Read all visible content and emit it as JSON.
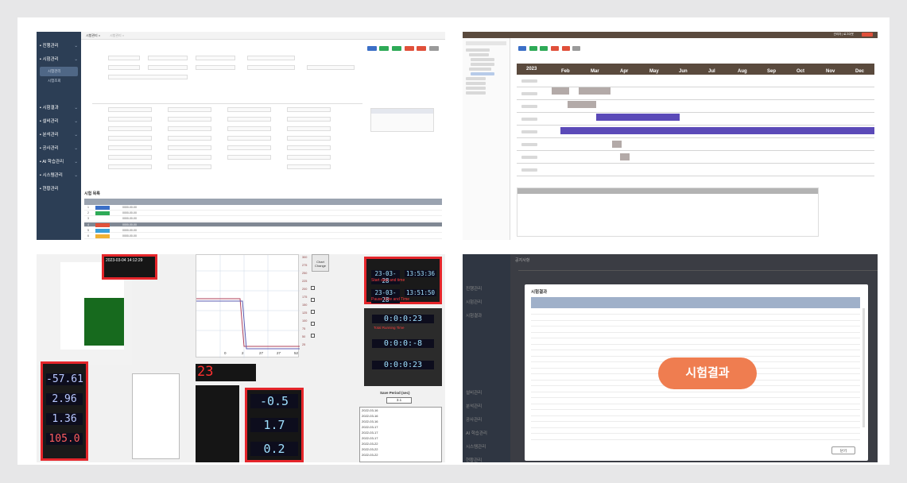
{
  "panel_top_left": {
    "tabs": [
      "시험관리 ×",
      "시험관리 ×"
    ],
    "sidebar": [
      {
        "label": "진행관리"
      },
      {
        "label": "시험관리"
      },
      {
        "label": "시험결과"
      },
      {
        "label": "설비관리"
      },
      {
        "label": "분석관리"
      },
      {
        "label": "공사관리"
      },
      {
        "label": "AI 학습관리"
      },
      {
        "label": "시스템관리"
      },
      {
        "label": "현황관리"
      }
    ],
    "sub_selected": "시험관리",
    "sub_other": "시험조회",
    "section_title": "시험 목록",
    "dates": [
      "0000-00-00",
      "0000-00-00",
      "0000-00-00",
      "0000-00-00",
      "0000-00-00",
      "0000-00-00",
      "0000-00-00",
      "0000-00-00"
    ],
    "row_numbers": [
      "1",
      "2",
      "3",
      "4",
      "5",
      "6",
      "7",
      "8"
    ],
    "chip_colors": [
      "#3b6fc7",
      "#2eaa57",
      "#ffffff",
      "#e0503a",
      "#3aa0d8",
      "#f0b133",
      "#27a9c9",
      "#2eaa57"
    ],
    "button_colors": [
      "#3b6fc7",
      "#2eaa57",
      "#2eaa57",
      "#e0503a",
      "#e0503a",
      "#9a9a9a"
    ]
  },
  "panel_top_right": {
    "year": "2023",
    "months": [
      "Feb",
      "Mar",
      "Apr",
      "May",
      "Jun",
      "Jul",
      "Aug",
      "Sep",
      "Oct",
      "Nov",
      "Dec"
    ],
    "top_status": "관리자 | 로그아웃"
  },
  "panel_bottom_left": {
    "timestamp": "2023-03-04 14:12:29",
    "readouts": [
      "-57.61",
      "2.96",
      "1.36",
      "105.0"
    ],
    "right_readouts": [
      "-0.5",
      "1.7",
      "0.2"
    ],
    "big_number": "23",
    "start_date": "23-03-28",
    "start_time": "13:53:36",
    "pause_date": "23-03-28",
    "pause_time": "13:51:50",
    "total_time": "0:0:0:23",
    "neg_time": "0:0:0:-8",
    "run_time": "0:0:0:23",
    "start_caption": "Start date and time",
    "pause_caption": "Pause Date and Time",
    "total_caption": "Total Running Time",
    "save_period_label": "Save Period (sec)",
    "save_period_value": "3.1",
    "chart_change": "Chart Change",
    "axis_ticks": [
      "0",
      "2",
      "27",
      "27",
      "52"
    ],
    "right_axis": [
      "300",
      "275",
      "250",
      "225",
      "200",
      "175",
      "150",
      "125",
      "100",
      "75",
      "50",
      "25"
    ],
    "log_dates": [
      "2022-03-16",
      "2022-03-16",
      "2022-03-16",
      "2022-03-17",
      "2022-03-17",
      "2022-03-17",
      "2022-03-22",
      "2022-03-22",
      "2022-03-22"
    ]
  },
  "panel_bottom_right": {
    "window_title": "시험결과",
    "callout": "시험결과",
    "close_label": "닫기",
    "breadcrumb": "공지사항",
    "sidebar": [
      {
        "label": "진행관리"
      },
      {
        "label": "시험관리"
      },
      {
        "label": "시험결과"
      },
      {
        "label": "설비관리"
      },
      {
        "label": "분석관리"
      },
      {
        "label": "공사관리"
      },
      {
        "label": "AI 학습관리"
      },
      {
        "label": "시스템관리"
      },
      {
        "label": "현황관리"
      }
    ]
  }
}
